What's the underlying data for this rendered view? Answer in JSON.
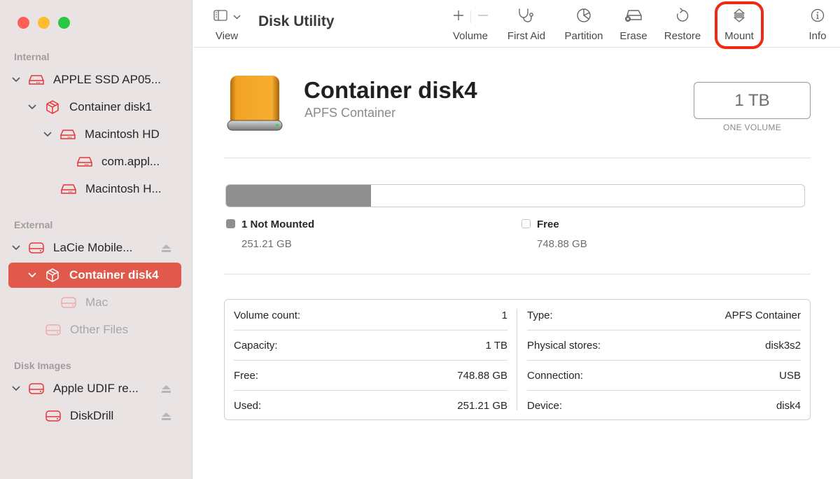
{
  "window": {
    "traffic_lights": [
      "close",
      "minimize",
      "zoom"
    ]
  },
  "sidebar": {
    "sections": [
      {
        "label": "Internal"
      },
      {
        "label": "External"
      },
      {
        "label": "Disk Images"
      }
    ],
    "items": [
      {
        "label": "APPLE SSD AP05...",
        "icon": "internal-drive-icon",
        "expanded": true,
        "level": 0
      },
      {
        "label": "Container disk1",
        "icon": "container-cube-icon",
        "expanded": true,
        "level": 1
      },
      {
        "label": "Macintosh HD",
        "icon": "internal-drive-icon",
        "expanded": true,
        "level": 2
      },
      {
        "label": "com.appl...",
        "icon": "internal-drive-icon",
        "level": 3
      },
      {
        "label": "Macintosh H...",
        "icon": "internal-drive-icon",
        "level": 2
      },
      {
        "label": "LaCie Mobile...",
        "icon": "external-drive-icon",
        "expanded": true,
        "level": 0,
        "eject": true
      },
      {
        "label": "Container disk4",
        "icon": "container-cube-icon",
        "expanded": true,
        "level": 1,
        "selected": true
      },
      {
        "label": "Mac",
        "icon": "external-drive-icon",
        "level": 2,
        "dimmed": true
      },
      {
        "label": "Other Files",
        "icon": "external-drive-icon",
        "level": 1,
        "dimmed": true
      },
      {
        "label": "Apple UDIF re...",
        "icon": "external-drive-icon",
        "expanded": true,
        "level": 0,
        "eject": true
      },
      {
        "label": "DiskDrill",
        "icon": "external-drive-icon",
        "level": 1,
        "eject": true
      }
    ]
  },
  "toolbar": {
    "title": "Disk Utility",
    "view_label": "View",
    "volume_label": "Volume",
    "first_aid_label": "First Aid",
    "partition_label": "Partition",
    "erase_label": "Erase",
    "restore_label": "Restore",
    "mount_label": "Mount",
    "info_label": "Info",
    "highlighted_button": "Mount"
  },
  "detail": {
    "name": "Container disk4",
    "subtitle": "APFS Container",
    "size": "1 TB",
    "size_caption": "ONE VOLUME",
    "usage": {
      "used_fraction": 0.2512,
      "segments": [
        {
          "name": "1 Not Mounted",
          "value": "251.21 GB",
          "color": "#8f8f8f"
        },
        {
          "name": "Free",
          "value": "748.88 GB",
          "color": "#ffffff"
        }
      ]
    },
    "info_left": [
      {
        "label": "Volume count:",
        "value": "1"
      },
      {
        "label": "Capacity:",
        "value": "1 TB"
      },
      {
        "label": "Free:",
        "value": "748.88 GB"
      },
      {
        "label": "Used:",
        "value": "251.21 GB"
      }
    ],
    "info_right": [
      {
        "label": "Type:",
        "value": "APFS Container"
      },
      {
        "label": "Physical stores:",
        "value": "disk3s2"
      },
      {
        "label": "Connection:",
        "value": "USB"
      },
      {
        "label": "Device:",
        "value": "disk4"
      }
    ]
  },
  "colors": {
    "accent": "#e0594a",
    "icon_red": "#e8343a",
    "highlight_ring": "#ee2a12"
  }
}
